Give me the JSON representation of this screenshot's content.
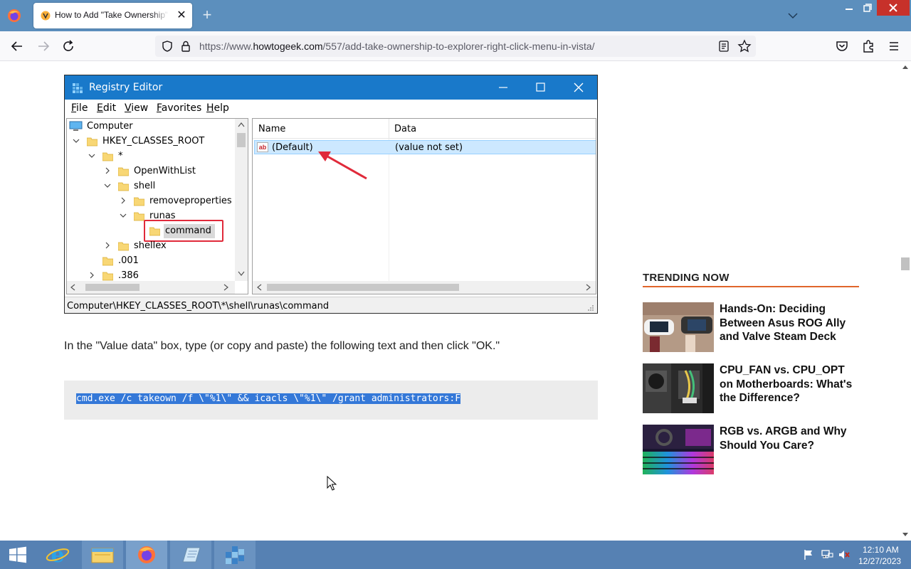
{
  "browser": {
    "tab_title": "How to Add \"Take Ownership\" to Explorer's Right-Click Menu in Vista",
    "url_prefix": "https://www.",
    "url_domain": "howtogeek.com",
    "url_path": "/557/add-take-ownership-to-explorer-right-click-menu-in-vista/"
  },
  "regedit": {
    "title": "Registry Editor",
    "menu": [
      "File",
      "Edit",
      "View",
      "Favorites",
      "Help"
    ],
    "tree": [
      {
        "label": "Computer"
      },
      {
        "label": "HKEY_CLASSES_ROOT"
      },
      {
        "label": "*"
      },
      {
        "label": "OpenWithList"
      },
      {
        "label": "shell"
      },
      {
        "label": "removeproperties"
      },
      {
        "label": "runas"
      },
      {
        "label": "command"
      },
      {
        "label": "shellex"
      },
      {
        "label": ".001"
      },
      {
        "label": ".386"
      }
    ],
    "columns": {
      "name": "Name",
      "data": "Data"
    },
    "row": {
      "icon_text": "ab",
      "name": "(Default)",
      "data": "(value not set)"
    },
    "status_path": "Computer\\HKEY_CLASSES_ROOT\\*\\shell\\runas\\command"
  },
  "article": {
    "instruction": "In the \"Value data\" box, type (or copy and paste) the following text and then click \"OK.\"",
    "code": "cmd.exe /c takeown /f \\\"%1\\\" && icacls \\\"%1\\\" /grant administrators:F"
  },
  "sidebar": {
    "heading": "TRENDING NOW",
    "items": [
      {
        "title": "Hands-On: Deciding Between Asus ROG Ally and Valve Steam Deck"
      },
      {
        "title": "CPU_FAN vs. CPU_OPT on Motherboards: What's the Difference?"
      },
      {
        "title": "RGB vs. ARGB and Why Should You Care?"
      }
    ]
  },
  "taskbar": {
    "time": "12:10 AM",
    "date": "12/27/2023"
  },
  "colors": {
    "tabstrip": "#5c8fbd",
    "taskbar": "#5681b3",
    "regedit_title": "#1979ca",
    "accent_rule": "#e0652b",
    "selection": "#3478d8"
  }
}
